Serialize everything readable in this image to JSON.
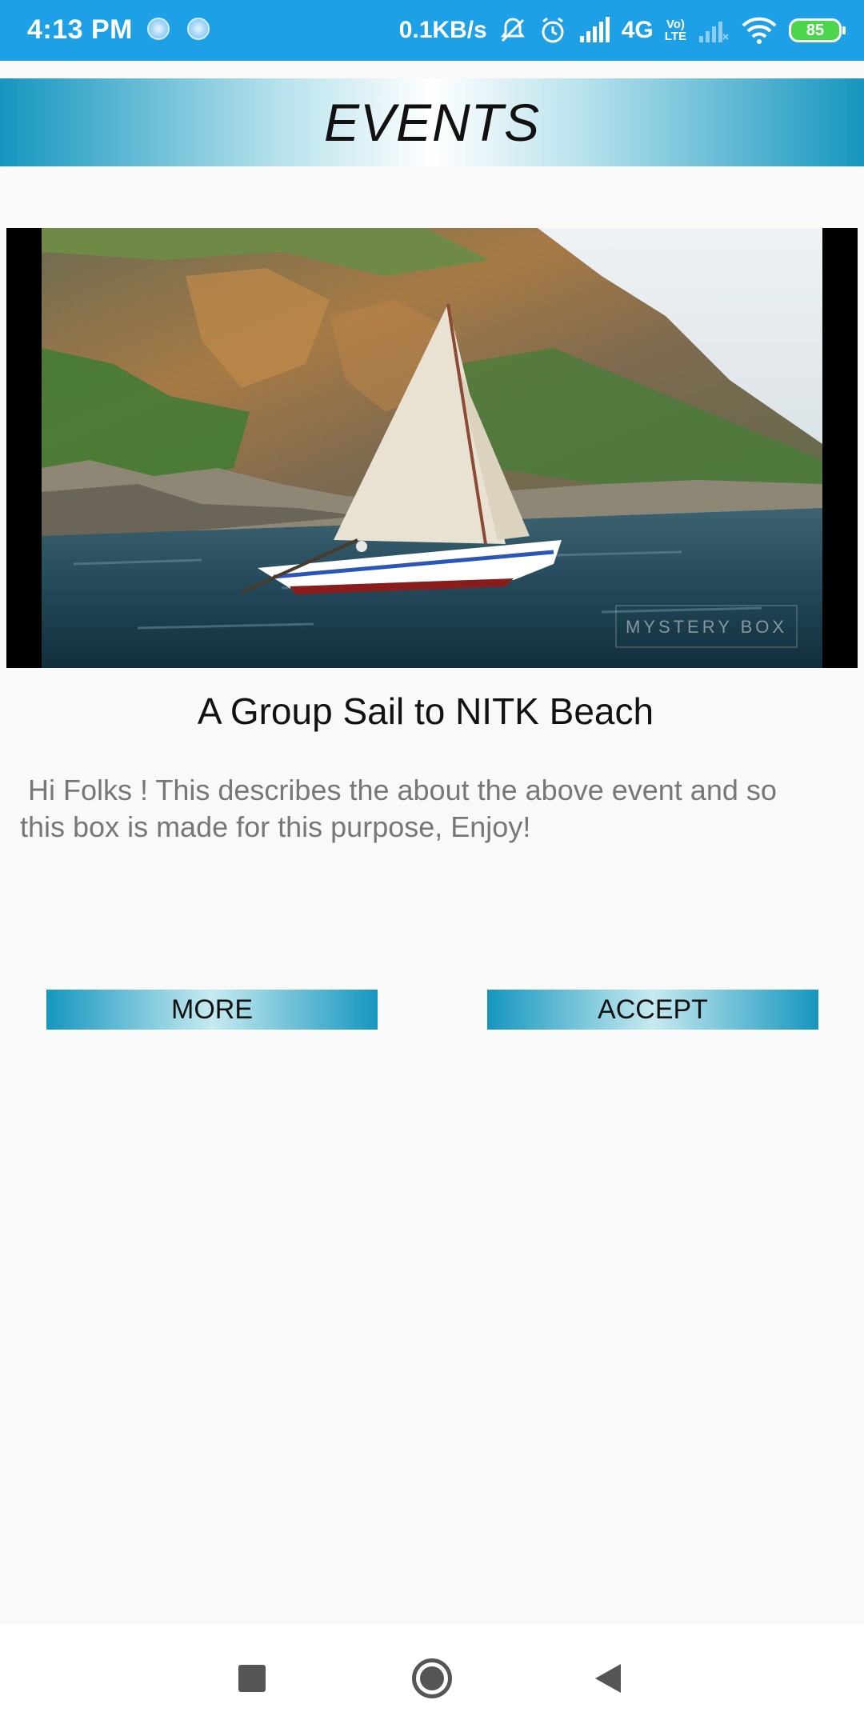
{
  "status_bar": {
    "time": "4:13 PM",
    "network_speed": "0.1KB/s",
    "network_type": "4G",
    "volte_label_top": "Vo)",
    "volte_label_bottom": "LTE",
    "battery_level": "85"
  },
  "header": {
    "title": "EVENTS"
  },
  "event": {
    "image_icon": "sailboat-photo",
    "image_watermark": "MYSTERY BOX",
    "title": "A Group Sail to NITK  Beach",
    "description": " Hi Folks ! This describes the about the above event and so this box is made for this purpose, Enjoy!"
  },
  "actions": {
    "more_label": "MORE",
    "accept_label": "ACCEPT"
  },
  "colors": {
    "status_bar": "#1ea0e6",
    "accent": "#1596bf",
    "background": "#f9f9f9"
  }
}
